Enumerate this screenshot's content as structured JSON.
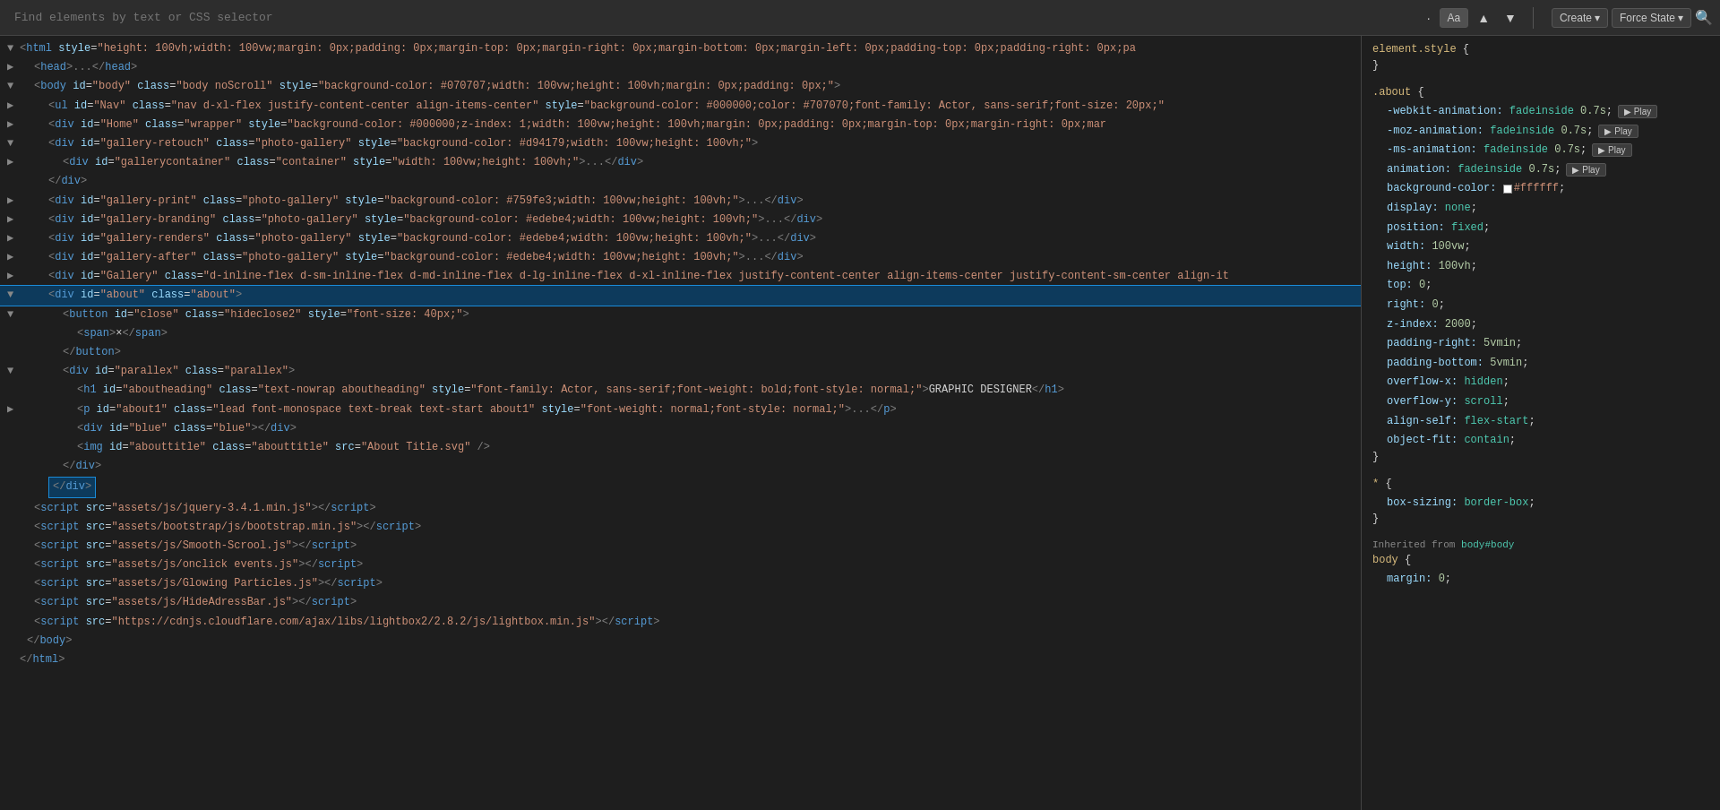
{
  "toolbar": {
    "search_placeholder": "Find elements by text or CSS selector",
    "btn_dot": "·",
    "btn_aa": "Aa",
    "btn_up": "▲",
    "btn_down": "▼",
    "btn_create": "Create",
    "btn_force_state": "Force State",
    "btn_force_state_arrow": "▾",
    "btn_search": "🔍"
  },
  "styles_panel": {
    "element_style_label": "element.style {",
    "element_style_close": "}",
    "about_selector": ".about {",
    "about_close": "}",
    "universal_selector": "* {",
    "universal_close": "}",
    "inherited_label": "Inherited from ",
    "inherited_link": "body#body",
    "body_selector": "body {",
    "body_close": "}",
    "properties": {
      "webkit_animation": "-webkit-animation:",
      "moz_animation": "-moz-animation:",
      "ms_animation": "-ms-animation:",
      "animation": "animation:",
      "background_color": "background-color:",
      "display": "display:",
      "position": "position:",
      "width": "width:",
      "height": "height:",
      "top": "top:",
      "right": "right:",
      "z_index": "z-index:",
      "padding_right": "padding-right:",
      "padding_bottom": "padding-bottom:",
      "overflow_x": "overflow-x:",
      "overflow_y": "overflow-y:",
      "align_self": "align-self:",
      "object_fit": "object-fit:",
      "box_sizing": "box-sizing:",
      "margin": "margin:"
    },
    "values": {
      "webkit_animation_val": "fadeinside 0.7s;",
      "moz_animation_val": "fadeinside 0.7s;",
      "ms_animation_val": "fadeinside 0.7s;",
      "animation_val": "fadeinside 0.7s;",
      "bg_color_val": "#ffffff;",
      "display_val": "none;",
      "position_val": "fixed;",
      "width_val": "100vw;",
      "height_val": "100vh;",
      "top_val": "0;",
      "right_val": "0;",
      "z_index_val": "2000;",
      "padding_right_val": "5vmin;",
      "padding_bottom_val": "5vmin;",
      "overflow_x_val": "hidden;",
      "overflow_y_val": "scroll;",
      "align_self_val": "flex-start;",
      "object_fit_val": "contain;",
      "box_sizing_val": "border-box;",
      "margin_val": "0;"
    },
    "play_label": "▶ Play"
  },
  "dom_tree": {
    "lines": [
      {
        "id": "l1",
        "indent": 0,
        "toggle": "▼",
        "content_html": "<span class='tag-bracket'>&lt;</span><span class='tag'>html</span> <span class='attr-name'>style</span>=<span class='attr-value'>\"height: 100vh;width: 100vw;margin: 0px;padding: 0px;margin-top: 0px;margin-right: 0px;margin-bottom: 0px;margin-left: 0px;padding-top: 0px;padding-right: 0px;pa</span>"
      },
      {
        "id": "l2",
        "indent": 1,
        "toggle": "▶",
        "content_html": "<span class='tag-bracket'>&lt;</span><span class='tag'>head</span><span class='tag-bracket'>&gt;</span><span class='ellipsis'>...</span><span class='tag-bracket'>&lt;/</span><span class='tag'>head</span><span class='tag-bracket'>&gt;</span>"
      },
      {
        "id": "l3",
        "indent": 1,
        "toggle": "▼",
        "content_html": "<span class='tag-bracket'>&lt;</span><span class='tag'>body</span> <span class='attr-name'>id</span>=<span class='attr-value'>\"body\"</span> <span class='attr-name'>class</span>=<span class='attr-value'>\"body noScroll\"</span> <span class='attr-name'>style</span>=<span class='attr-value'>\"background-color: #070707;width: 100vw;height: 100vh;margin: 0px;padding: 0px;\"</span><span class='tag-bracket'>&gt;</span>"
      },
      {
        "id": "l4",
        "indent": 2,
        "toggle": "▶",
        "content_html": "<span class='tag-bracket'>&lt;</span><span class='tag'>ul</span> <span class='attr-name'>id</span>=<span class='attr-value'>\"Nav\"</span> <span class='attr-name'>class</span>=<span class='attr-value'>\"nav d-xl-flex justify-content-center align-items-center\"</span> <span class='attr-name'>style</span>=<span class='attr-value'>\"background-color: #000000;color: #707070;font-family: Actor, sans-serif;font-size: 20px;\"</span>"
      },
      {
        "id": "l5",
        "indent": 2,
        "toggle": "▶",
        "content_html": "<span class='tag-bracket'>&lt;</span><span class='tag'>div</span> <span class='attr-name'>id</span>=<span class='attr-value'>\"Home\"</span> <span class='attr-name'>class</span>=<span class='attr-value'>\"wrapper\"</span> <span class='attr-name'>style</span>=<span class='attr-value'>\"background-color: #000000;z-index: 1;width: 100vw;height: 100vh;margin: 0px;padding: 0px;margin-top: 0px;margin-right: 0px;mar</span>"
      },
      {
        "id": "l6",
        "indent": 2,
        "toggle": "▼",
        "content_html": "<span class='tag-bracket'>&lt;</span><span class='tag'>div</span> <span class='attr-name'>id</span>=<span class='attr-value'>\"gallery-retouch\"</span> <span class='attr-name'>class</span>=<span class='attr-value'>\"photo-gallery\"</span> <span class='attr-name'>style</span>=<span class='attr-value'>\"background-color: #d94179;width: 100vw;height: 100vh;\"</span><span class='tag-bracket'>&gt;</span>"
      },
      {
        "id": "l7",
        "indent": 3,
        "toggle": "▶",
        "content_html": "<span class='tag-bracket'>&lt;</span><span class='tag'>div</span> <span class='attr-name'>id</span>=<span class='attr-value'>\"gallerycontainer\"</span> <span class='attr-name'>class</span>=<span class='attr-value'>\"container\"</span> <span class='attr-name'>style</span>=<span class='attr-value'>\"width: 100vw;height: 100vh;\"</span><span class='tag-bracket'>&gt;</span><span class='ellipsis'>...</span><span class='tag-bracket'>&lt;/</span><span class='tag'>div</span><span class='tag-bracket'>&gt;</span>"
      },
      {
        "id": "l8",
        "indent": 2,
        "toggle": "",
        "content_html": "<span class='tag-bracket'>&lt;/</span><span class='tag'>div</span><span class='tag-bracket'>&gt;</span>"
      },
      {
        "id": "l9",
        "indent": 2,
        "toggle": "▶",
        "content_html": "<span class='tag-bracket'>&lt;</span><span class='tag'>div</span> <span class='attr-name'>id</span>=<span class='attr-value'>\"gallery-print\"</span> <span class='attr-name'>class</span>=<span class='attr-value'>\"photo-gallery\"</span> <span class='attr-name'>style</span>=<span class='attr-value'>\"background-color: #759fe3;width: 100vw;height: 100vh;\"</span><span class='tag-bracket'>&gt;</span><span class='ellipsis'>...</span><span class='tag-bracket'>&lt;/</span><span class='tag'>div</span><span class='tag-bracket'>&gt;</span>"
      },
      {
        "id": "l10",
        "indent": 2,
        "toggle": "▶",
        "content_html": "<span class='tag-bracket'>&lt;</span><span class='tag'>div</span> <span class='attr-name'>id</span>=<span class='attr-value'>\"gallery-branding\"</span> <span class='attr-name'>class</span>=<span class='attr-value'>\"photo-gallery\"</span> <span class='attr-name'>style</span>=<span class='attr-value'>\"background-color: #edebe4;width: 100vw;height: 100vh;\"</span><span class='tag-bracket'>&gt;</span><span class='ellipsis'>...</span><span class='tag-bracket'>&lt;/</span><span class='tag'>div</span><span class='tag-bracket'>&gt;</span>"
      },
      {
        "id": "l11",
        "indent": 2,
        "toggle": "▶",
        "content_html": "<span class='tag-bracket'>&lt;</span><span class='tag'>div</span> <span class='attr-name'>id</span>=<span class='attr-value'>\"gallery-renders\"</span> <span class='attr-name'>class</span>=<span class='attr-value'>\"photo-gallery\"</span> <span class='attr-name'>style</span>=<span class='attr-value'>\"background-color: #edebe4;width: 100vw;height: 100vh;\"</span><span class='tag-bracket'>&gt;</span><span class='ellipsis'>...</span><span class='tag-bracket'>&lt;/</span><span class='tag'>div</span><span class='tag-bracket'>&gt;</span>"
      },
      {
        "id": "l12",
        "indent": 2,
        "toggle": "▶",
        "content_html": "<span class='tag-bracket'>&lt;</span><span class='tag'>div</span> <span class='attr-name'>id</span>=<span class='attr-value'>\"gallery-after\"</span> <span class='attr-name'>class</span>=<span class='attr-value'>\"photo-gallery\"</span> <span class='attr-name'>style</span>=<span class='attr-value'>\"background-color: #edebe4;width: 100vw;height: 100vh;\"</span><span class='tag-bracket'>&gt;</span><span class='ellipsis'>...</span><span class='tag-bracket'>&lt;/</span><span class='tag'>div</span><span class='tag-bracket'>&gt;</span>"
      },
      {
        "id": "l13",
        "indent": 2,
        "toggle": "▶",
        "content_html": "<span class='tag-bracket'>&lt;</span><span class='tag'>div</span> <span class='attr-name'>id</span>=<span class='attr-value'>\"Gallery\"</span> <span class='attr-name'>class</span>=<span class='attr-value'>\"d-inline-flex d-sm-inline-flex d-md-inline-flex d-lg-inline-flex d-xl-inline-flex justify-content-center align-items-center justify-content-sm-center align-it</span>"
      },
      {
        "id": "l14",
        "indent": 2,
        "toggle": "▼",
        "content_html": "<span class='tag-bracket'>&lt;</span><span class='tag'>div</span> <span class='attr-name'>id</span>=<span class='attr-value'>\"about\"</span> <span class='attr-name'>class</span>=<span class='attr-value'>\"about\"</span><span class='tag-bracket'>&gt;</span>",
        "selected": true
      },
      {
        "id": "l15",
        "indent": 3,
        "toggle": "▼",
        "content_html": "<span class='tag-bracket'>&lt;</span><span class='tag'>button</span> <span class='attr-name'>id</span>=<span class='attr-value'>\"close\"</span> <span class='attr-name'>class</span>=<span class='attr-value'>\"hideclose2\"</span> <span class='attr-name'>style</span>=<span class='attr-value'>\"font-size: 40px;\"</span><span class='tag-bracket'>&gt;</span>"
      },
      {
        "id": "l16",
        "indent": 4,
        "toggle": "",
        "content_html": "<span class='tag-bracket'>&lt;</span><span class='tag'>span</span><span class='tag-bracket'>&gt;</span><span class='text-content'>×</span><span class='tag-bracket'>&lt;/</span><span class='tag'>span</span><span class='tag-bracket'>&gt;</span>"
      },
      {
        "id": "l17",
        "indent": 3,
        "toggle": "",
        "content_html": "<span class='tag-bracket'>&lt;/</span><span class='tag'>button</span><span class='tag-bracket'>&gt;</span>"
      },
      {
        "id": "l18",
        "indent": 3,
        "toggle": "▼",
        "content_html": "<span class='tag-bracket'>&lt;</span><span class='tag'>div</span> <span class='attr-name'>id</span>=<span class='attr-value'>\"parallex\"</span> <span class='attr-name'>class</span>=<span class='attr-value'>\"parallex\"</span><span class='tag-bracket'>&gt;</span>"
      },
      {
        "id": "l19",
        "indent": 4,
        "toggle": "",
        "content_html": "<span class='tag-bracket'>&lt;</span><span class='tag'>h1</span> <span class='attr-name'>id</span>=<span class='attr-value'>\"aboutheading\"</span> <span class='attr-name'>class</span>=<span class='attr-value'>\"text-nowrap aboutheading\"</span> <span class='attr-name'>style</span>=<span class='attr-value'>\"font-family: Actor, sans-serif;font-weight: bold;font-style: normal;\"</span><span class='tag-bracket'>&gt;</span><span class='text-content'>GRAPHIC DESIGNER</span><span class='tag-bracket'>&lt;/</span><span class='tag'>h1</span><span class='tag-bracket'>&gt;</span>"
      },
      {
        "id": "l20",
        "indent": 4,
        "toggle": "▶",
        "content_html": "<span class='tag-bracket'>&lt;</span><span class='tag'>p</span> <span class='attr-name'>id</span>=<span class='attr-value'>\"about1\"</span> <span class='attr-name'>class</span>=<span class='attr-value'>\"lead font-monospace text-break text-start about1\"</span> <span class='attr-name'>style</span>=<span class='attr-value'>\"font-weight: normal;font-style: normal;\"</span><span class='tag-bracket'>&gt;</span><span class='ellipsis'>...</span><span class='tag-bracket'>&lt;/</span><span class='tag'>p</span><span class='tag-bracket'>&gt;</span>"
      },
      {
        "id": "l21",
        "indent": 4,
        "toggle": "",
        "content_html": "<span class='tag-bracket'>&lt;</span><span class='tag'>div</span> <span class='attr-name'>id</span>=<span class='attr-value'>\"blue\"</span> <span class='attr-name'>class</span>=<span class='attr-value'>\"blue\"</span><span class='tag-bracket'>&gt;</span><span class='tag-bracket'>&lt;/</span><span class='tag'>div</span><span class='tag-bracket'>&gt;</span>"
      },
      {
        "id": "l22",
        "indent": 4,
        "toggle": "",
        "content_html": "<span class='tag-bracket'>&lt;</span><span class='tag'>img</span> <span class='attr-name'>id</span>=<span class='attr-value'>\"abouttitle\"</span> <span class='attr-name'>class</span>=<span class='attr-value'>\"abouttitle\"</span> <span class='attr-name'>src</span>=<span class='attr-value'>\"About Title.svg\"</span> <span class='tag-bracket'>/&gt;</span>"
      },
      {
        "id": "l23",
        "indent": 3,
        "toggle": "",
        "content_html": "<span class='tag-bracket'>&lt;/</span><span class='tag'>div</span><span class='tag-bracket'>&gt;</span>"
      },
      {
        "id": "l24",
        "indent": 2,
        "toggle": "",
        "content_html": "<span class='tag-bracket selected-tag'>&lt;/</span><span class='tag'>div</span><span class='tag-bracket'>&gt;</span>",
        "closing_selected": true
      },
      {
        "id": "l25",
        "indent": 1,
        "toggle": "",
        "content_html": "<span class='script-tag'>&lt;</span><span class='tag'>script</span> <span class='attr-name'>src</span>=<span class='attr-value'>\"assets/js/jquery-3.4.1.min.js\"</span><span class='tag-bracket'>&gt;&lt;/</span><span class='tag'>script</span><span class='tag-bracket'>&gt;</span>"
      },
      {
        "id": "l26",
        "indent": 1,
        "toggle": "",
        "content_html": "<span class='script-tag'>&lt;</span><span class='tag'>script</span> <span class='attr-name'>src</span>=<span class='attr-value'>\"assets/bootstrap/js/bootstrap.min.js\"</span><span class='tag-bracket'>&gt;&lt;/</span><span class='tag'>script</span><span class='tag-bracket'>&gt;</span>"
      },
      {
        "id": "l27",
        "indent": 1,
        "toggle": "",
        "content_html": "<span class='script-tag'>&lt;</span><span class='tag'>script</span> <span class='attr-name'>src</span>=<span class='attr-value'>\"assets/js/Smooth-Scrool.js\"</span><span class='tag-bracket'>&gt;&lt;/</span><span class='tag'>script</span><span class='tag-bracket'>&gt;</span>"
      },
      {
        "id": "l28",
        "indent": 1,
        "toggle": "",
        "content_html": "<span class='script-tag'>&lt;</span><span class='tag'>script</span> <span class='attr-name'>src</span>=<span class='attr-value'>\"assets/js/onclick events.js\"</span><span class='tag-bracket'>&gt;&lt;/</span><span class='tag'>script</span><span class='tag-bracket'>&gt;</span>"
      },
      {
        "id": "l29",
        "indent": 1,
        "toggle": "",
        "content_html": "<span class='script-tag'>&lt;</span><span class='tag'>script</span> <span class='attr-name'>src</span>=<span class='attr-value'>\"assets/js/Glowing Particles.js\"</span><span class='tag-bracket'>&gt;&lt;/</span><span class='tag'>script</span><span class='tag-bracket'>&gt;</span>"
      },
      {
        "id": "l30",
        "indent": 1,
        "toggle": "",
        "content_html": "<span class='script-tag'>&lt;</span><span class='tag'>script</span> <span class='attr-name'>src</span>=<span class='attr-value'>\"assets/js/HideAdressBar.js\"</span><span class='tag-bracket'>&gt;&lt;/</span><span class='tag'>script</span><span class='tag-bracket'>&gt;</span>"
      },
      {
        "id": "l31",
        "indent": 1,
        "toggle": "",
        "content_html": "<span class='script-tag'>&lt;</span><span class='tag'>script</span> <span class='attr-name'>src</span>=<span class='attr-value'>\"https://cdnjs.cloudflare.com/ajax/libs/lightbox2/2.8.2/js/lightbox.min.js\"</span><span class='tag-bracket'>&gt;&lt;/</span><span class='tag'>script</span><span class='tag-bracket'>&gt;</span>"
      },
      {
        "id": "l32",
        "indent": 0,
        "toggle": "",
        "content_html": "<span class='tag-bracket'>&lt;/</span><span class='tag'>body</span><span class='tag-bracket'>&gt;</span>"
      },
      {
        "id": "l33",
        "indent": 0,
        "toggle": "",
        "content_html": "<span class='tag-bracket'>&lt;/</span><span class='tag'>html</span><span class='tag-bracket'>&gt;</span>"
      }
    ]
  }
}
